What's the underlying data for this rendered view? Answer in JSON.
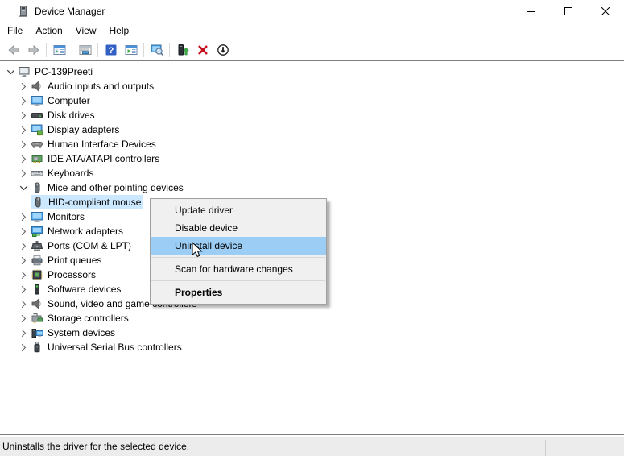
{
  "window": {
    "title": "Device Manager"
  },
  "menubar": {
    "items": [
      {
        "label": "File"
      },
      {
        "label": "Action"
      },
      {
        "label": "View"
      },
      {
        "label": "Help"
      }
    ]
  },
  "toolbar": {
    "icons": [
      "back-icon",
      "forward-icon",
      "show-console-tree-icon",
      "properties-window-icon",
      "help-icon",
      "action-pane-icon",
      "scan-hardware-icon",
      "update-driver-icon",
      "uninstall-icon",
      "disable-icon"
    ]
  },
  "tree": {
    "items": [
      {
        "label": "PC-139Preeti",
        "level": 0,
        "state": "expanded",
        "icon": "computer-root-icon",
        "selected": false
      },
      {
        "label": "Audio inputs and outputs",
        "level": 1,
        "state": "collapsed",
        "icon": "audio-icon",
        "selected": false
      },
      {
        "label": "Computer",
        "level": 1,
        "state": "collapsed",
        "icon": "monitor-icon",
        "selected": false
      },
      {
        "label": "Disk drives",
        "level": 1,
        "state": "collapsed",
        "icon": "disk-icon",
        "selected": false
      },
      {
        "label": "Display adapters",
        "level": 1,
        "state": "collapsed",
        "icon": "display-adapter-icon",
        "selected": false
      },
      {
        "label": "Human Interface Devices",
        "level": 1,
        "state": "collapsed",
        "icon": "hid-icon",
        "selected": false
      },
      {
        "label": "IDE ATA/ATAPI controllers",
        "level": 1,
        "state": "collapsed",
        "icon": "ide-icon",
        "selected": false
      },
      {
        "label": "Keyboards",
        "level": 1,
        "state": "collapsed",
        "icon": "keyboard-icon",
        "selected": false
      },
      {
        "label": "Mice and other pointing devices",
        "level": 1,
        "state": "expanded",
        "icon": "mouse-icon",
        "selected": false
      },
      {
        "label": "HID-compliant mouse",
        "level": 2,
        "state": "none",
        "icon": "mouse-icon",
        "selected": true
      },
      {
        "label": "Monitors",
        "level": 1,
        "state": "collapsed",
        "icon": "monitor-icon",
        "selected": false
      },
      {
        "label": "Network adapters",
        "level": 1,
        "state": "collapsed",
        "icon": "network-icon",
        "selected": false
      },
      {
        "label": "Ports (COM & LPT)",
        "level": 1,
        "state": "collapsed",
        "icon": "port-icon",
        "selected": false
      },
      {
        "label": "Print queues",
        "level": 1,
        "state": "collapsed",
        "icon": "printer-icon",
        "selected": false
      },
      {
        "label": "Processors",
        "level": 1,
        "state": "collapsed",
        "icon": "processor-icon",
        "selected": false
      },
      {
        "label": "Software devices",
        "level": 1,
        "state": "collapsed",
        "icon": "software-device-icon",
        "selected": false
      },
      {
        "label": "Sound, video and game controllers",
        "level": 1,
        "state": "collapsed",
        "icon": "audio-icon",
        "selected": false
      },
      {
        "label": "Storage controllers",
        "level": 1,
        "state": "collapsed",
        "icon": "storage-icon",
        "selected": false
      },
      {
        "label": "System devices",
        "level": 1,
        "state": "collapsed",
        "icon": "system-icon",
        "selected": false
      },
      {
        "label": "Universal Serial Bus controllers",
        "level": 1,
        "state": "collapsed",
        "icon": "usb-icon",
        "selected": false
      }
    ]
  },
  "context_menu": {
    "items": [
      {
        "label": "Update driver",
        "highlighted": false,
        "bold": false
      },
      {
        "label": "Disable device",
        "highlighted": false,
        "bold": false
      },
      {
        "label": "Uninstall device",
        "highlighted": true,
        "bold": false
      },
      {
        "label": "Scan for hardware changes",
        "highlighted": false,
        "bold": false
      },
      {
        "label": "Properties",
        "highlighted": false,
        "bold": true
      }
    ]
  },
  "statusbar": {
    "text": "Uninstalls the driver for the selected device."
  },
  "colors": {
    "menu_highlight": "#9bcdf5",
    "tree_selection": "#cce8ff",
    "uninstall_red": "#c50f1f",
    "help_blue": "#3360c4",
    "statusbar_bg": "#ececec"
  }
}
